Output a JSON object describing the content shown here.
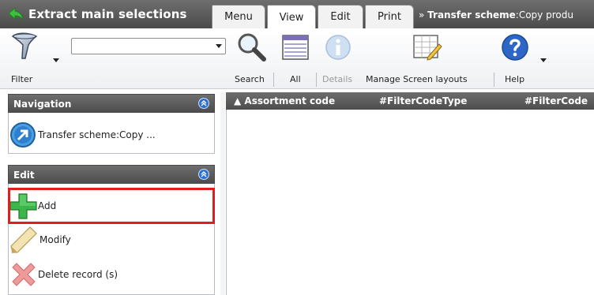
{
  "window": {
    "title": "Extract main selections",
    "tabs": [
      "Menu",
      "View",
      "Edit",
      "Print"
    ],
    "active_tab": "View",
    "breadcrumb_prefix": "»",
    "breadcrumb_bold": "Transfer scheme",
    "breadcrumb_rest": ":Copy produ"
  },
  "toolbar": {
    "filter_label": "Filter",
    "filter_value": "",
    "search_label": "Search",
    "all_label": "All",
    "details_label": "Details",
    "manage_layouts_label": "Manage Screen layouts",
    "help_label": "Help"
  },
  "navigation": {
    "header": "Navigation",
    "item_label": "Transfer scheme:Copy ..."
  },
  "edit": {
    "header": "Edit",
    "add_label": "Add",
    "modify_label": "Modify",
    "delete_label": "Delete record (s)"
  },
  "grid": {
    "sort_indicator": "▲",
    "columns": [
      "Assortment code",
      "#FilterCodeType",
      "#FilterCode"
    ]
  },
  "colors": {
    "highlight_border": "#e01e1e",
    "header_dark": "#555555",
    "accent_blue": "#2a6fd6"
  }
}
